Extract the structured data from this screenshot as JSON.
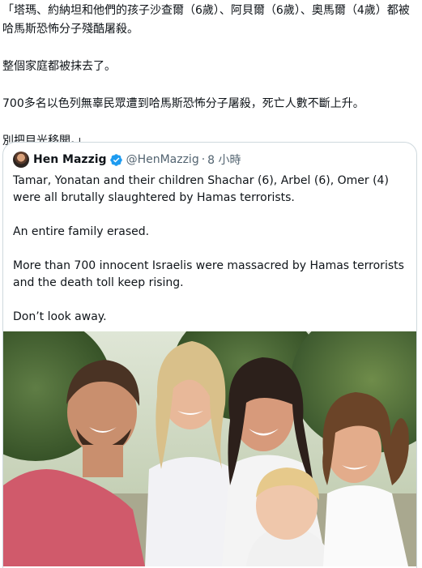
{
  "tweet": {
    "lines": [
      "「塔瑪、約納坦和他們的孩子沙查爾（6歲）、阿貝爾（6歲）、奧馬爾（4歲）都被哈馬斯恐怖分子殘酷屠殺。",
      "整個家庭都被抹去了。",
      "700多名以色列無辜民眾遭到哈馬斯恐怖分子屠殺，死亡人數不斷上升。",
      "別把目光移開。」"
    ]
  },
  "quote": {
    "author_name": "Hen Mazzig",
    "handle": "@HenMazzig",
    "separator": "·",
    "time": "8 小時",
    "verified_icon": "verified-badge-icon",
    "paragraphs": [
      "Tamar, Yonatan and their children Shachar (6), Arbel (6), Omer (4) were all brutally slaughtered by Hamas terrorists.",
      "An entire family erased.",
      "More than 700 innocent Israelis were massacred by Hamas terrorists and the death toll keep rising.",
      "Don’t look away."
    ],
    "photo": "family-photo"
  },
  "colors": {
    "text": "#0f1419",
    "secondary": "#536471",
    "border": "#cfd9de",
    "verified": "#1d9bf0"
  }
}
